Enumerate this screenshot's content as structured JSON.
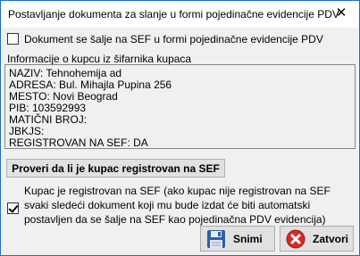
{
  "window": {
    "title": "Postavljanje dokumenta za slanje u formi pojedinačne evidencije PDV"
  },
  "sef_checkbox": {
    "label": "Dokument se šalje na SEF u formi pojedinačne evidencije PDV",
    "checked": false
  },
  "info": {
    "section_label": "Informacije o kupcu iz šifarnika kupaca",
    "lines": [
      "NAZIV: Tehnohemija ad",
      "ADRESA: Bul. Mihajla Pupina 256",
      "MESTO: Novi Beograd",
      "PIB: 103592993",
      "MATIČNI BROJ:",
      "JBKJS:",
      "REGISTROVAN NA SEF: DA"
    ]
  },
  "check_button": {
    "label": "Proveri da li je kupac registrovan na SEF"
  },
  "auto_checkbox": {
    "label": "Kupac je registrovan na SEF (ako kupac nije registrovan na SEF svaki sledeći dokument koji mu bude izdat će biti automatski postavljen da se šalje na SEF kao pojedinačna PDV evidencija)",
    "checked": true
  },
  "buttons": {
    "save_label": "Snimi",
    "close_label": "Zatvori"
  },
  "colors": {
    "window_border": "#1a6fc9",
    "client_bg": "#f0f0f0",
    "button_bg": "#e1e1e1",
    "close_icon_red": "#d42a2a",
    "save_icon_blue": "#2d5ea8"
  }
}
